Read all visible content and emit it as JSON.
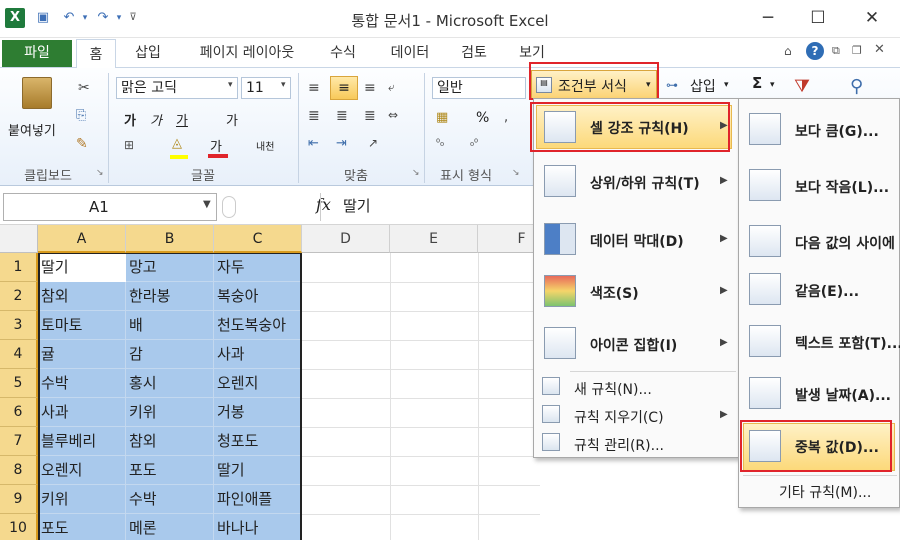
{
  "app": {
    "title": "통합 문서1 - Microsoft Excel",
    "logo": "X"
  },
  "quick_access": {
    "save_icon": "save-icon",
    "undo_icon": "undo-icon",
    "redo_icon": "redo-icon"
  },
  "window": {
    "minimize": "─",
    "maximize": "☐",
    "close": "✕"
  },
  "tabs": {
    "file": "파일",
    "home": "홈",
    "insert": "삽입",
    "layout": "페이지 레이아웃",
    "formula": "수식",
    "data": "데이터",
    "review": "검토",
    "view": "보기"
  },
  "ribbon": {
    "clipboard": {
      "paste": "붙여넣기",
      "group": "클립보드"
    },
    "font": {
      "name": "맑은 고딕",
      "size": "11",
      "group": "글꼴",
      "bold": "가",
      "italic": "가",
      "underline": "가",
      "grow": "가",
      "color_char": "가",
      "phonetic": "내천"
    },
    "align": {
      "group": "맞춤"
    },
    "number": {
      "format": "일반",
      "group": "표시 형식",
      "percent": "%"
    },
    "styles": {
      "conditional": "조건부 서식"
    },
    "cells": {
      "insert": "삽입"
    },
    "editing": {
      "sum": "Σ"
    }
  },
  "formula_bar": {
    "cell_ref": "A1",
    "fx": "fx",
    "value": "딸기"
  },
  "grid": {
    "columns": [
      "A",
      "B",
      "C",
      "D",
      "E",
      "F"
    ],
    "rows": [
      "1",
      "2",
      "3",
      "4",
      "5",
      "6",
      "7",
      "8",
      "9",
      "10"
    ],
    "data": [
      [
        "딸기",
        "망고",
        "자두"
      ],
      [
        "참외",
        "한라봉",
        "복숭아"
      ],
      [
        "토마토",
        "배",
        "천도복숭아"
      ],
      [
        "귤",
        "감",
        "사과"
      ],
      [
        "수박",
        "홍시",
        "오렌지"
      ],
      [
        "사과",
        "키위",
        "거봉"
      ],
      [
        "블루베리",
        "참외",
        "청포도"
      ],
      [
        "오렌지",
        "포도",
        "딸기"
      ],
      [
        "키위",
        "수박",
        "파인애플"
      ],
      [
        "포도",
        "메론",
        "바나나"
      ]
    ]
  },
  "menu_main": {
    "items": [
      {
        "label": "셀 강조 규칙(H)",
        "icon": "highlight-cells-icon"
      },
      {
        "label": "상위/하위 규칙(T)",
        "icon": "top-bottom-icon"
      },
      {
        "label": "데이터 막대(D)",
        "icon": "data-bars-icon"
      },
      {
        "label": "색조(S)",
        "icon": "color-scales-icon"
      },
      {
        "label": "아이콘 집합(I)",
        "icon": "icon-sets-icon"
      }
    ],
    "small_items": [
      {
        "label": "새 규칙(N)...",
        "icon": "new-rule-icon"
      },
      {
        "label": "규칙 지우기(C)",
        "icon": "clear-rules-icon"
      },
      {
        "label": "규칙 관리(R)...",
        "icon": "manage-rules-icon"
      }
    ]
  },
  "menu_sub": {
    "items": [
      {
        "label": "보다 큼(G)...",
        "icon": "greater-than-icon"
      },
      {
        "label": "보다 작음(L)...",
        "icon": "less-than-icon"
      },
      {
        "label": "다음 값의 사이에",
        "icon": "between-icon"
      },
      {
        "label": "같음(E)...",
        "icon": "equal-to-icon"
      },
      {
        "label": "텍스트 포함(T)...",
        "icon": "text-contains-icon"
      },
      {
        "label": "발생 날짜(A)...",
        "icon": "date-occurring-icon"
      },
      {
        "label": "중복 값(D)...",
        "icon": "duplicate-values-icon"
      }
    ],
    "more": "기타 규칙(M)..."
  },
  "colors": {
    "selection": "#a9c9ec",
    "highlight_border": "#e0242b",
    "file_tab": "#2e7d32"
  }
}
